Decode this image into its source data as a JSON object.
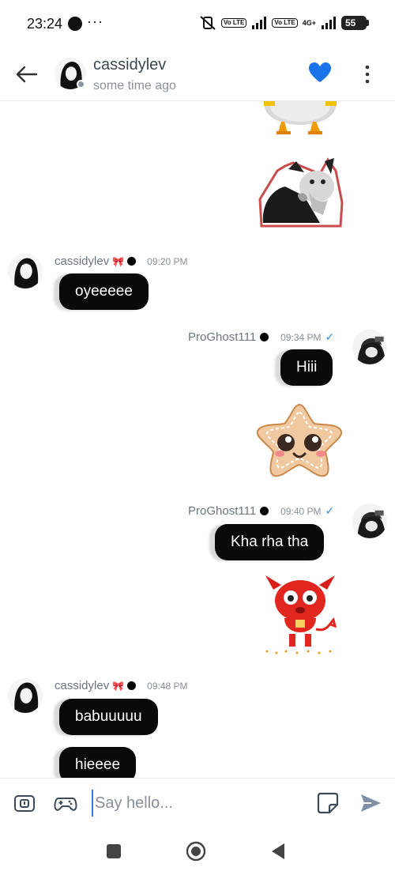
{
  "status_bar": {
    "time": "23:24",
    "more": "···",
    "vo_label": "Vo LTE",
    "network_label": "4G+",
    "battery": "55"
  },
  "header": {
    "name": "cassidylev",
    "status": "some time ago"
  },
  "messages": [
    {
      "sender": "cassidylev",
      "sender_tag": "🎀",
      "time": "09:20 PM",
      "text": "oyeeeee"
    },
    {
      "sender": "ProGhost111",
      "time": "09:34 PM",
      "text": "Hiii"
    },
    {
      "sender": "ProGhost111",
      "time": "09:40 PM",
      "text": "Kha rha tha"
    },
    {
      "sender": "cassidylev",
      "sender_tag": "🎀",
      "time": "09:48 PM",
      "text": "babuuuuu"
    },
    {
      "text": "hieeee"
    }
  ],
  "stickers": [
    "chicken-sticker",
    "cat-sticker",
    "gingerbread-star-sticker",
    "red-devil-sticker"
  ],
  "composer": {
    "placeholder": "Say hello..."
  },
  "colors": {
    "accent_blue": "#2f7fe0",
    "heart_blue": "#1a73e8",
    "bubble_black": "#0a0a0a"
  }
}
